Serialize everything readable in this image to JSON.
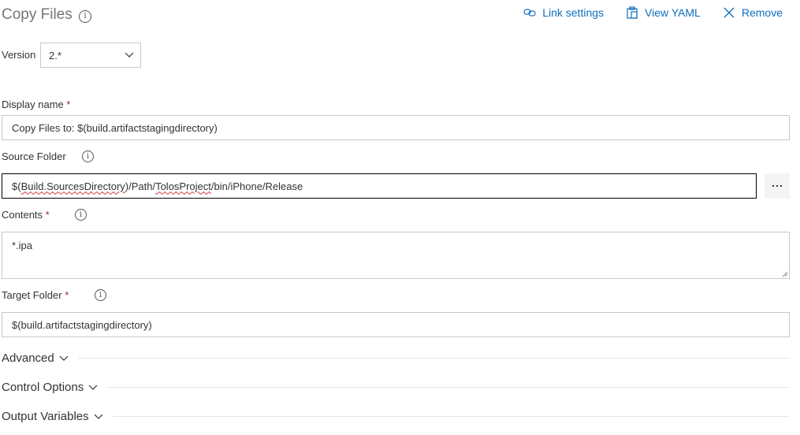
{
  "header": {
    "title": "Copy Files",
    "actions": {
      "link_settings": "Link settings",
      "view_yaml": "View YAML",
      "remove": "Remove"
    }
  },
  "version": {
    "label": "Version",
    "selected": "2.*"
  },
  "fields": {
    "display_name": {
      "label": "Display name",
      "required_mark": "*",
      "value": "Copy Files to: $(build.artifactstagingdirectory)"
    },
    "source_folder": {
      "label": "Source Folder",
      "value_parts": [
        "$(",
        "Build.SourcesDirectory",
        ")/Path/",
        "TolosProject",
        "/bin/iPhone/Release"
      ],
      "browse_label": "..."
    },
    "contents": {
      "label": "Contents",
      "required_mark": "*",
      "value": "*.ipa"
    },
    "target_folder": {
      "label": "Target Folder",
      "required_mark": "*",
      "value": "$(build.artifactstagingdirectory)"
    }
  },
  "sections": [
    {
      "label": "Advanced"
    },
    {
      "label": "Control Options"
    },
    {
      "label": "Output Variables"
    }
  ],
  "colors": {
    "accent": "#106ebe",
    "required": "#a4262c",
    "spellcheck": "#d13438"
  }
}
